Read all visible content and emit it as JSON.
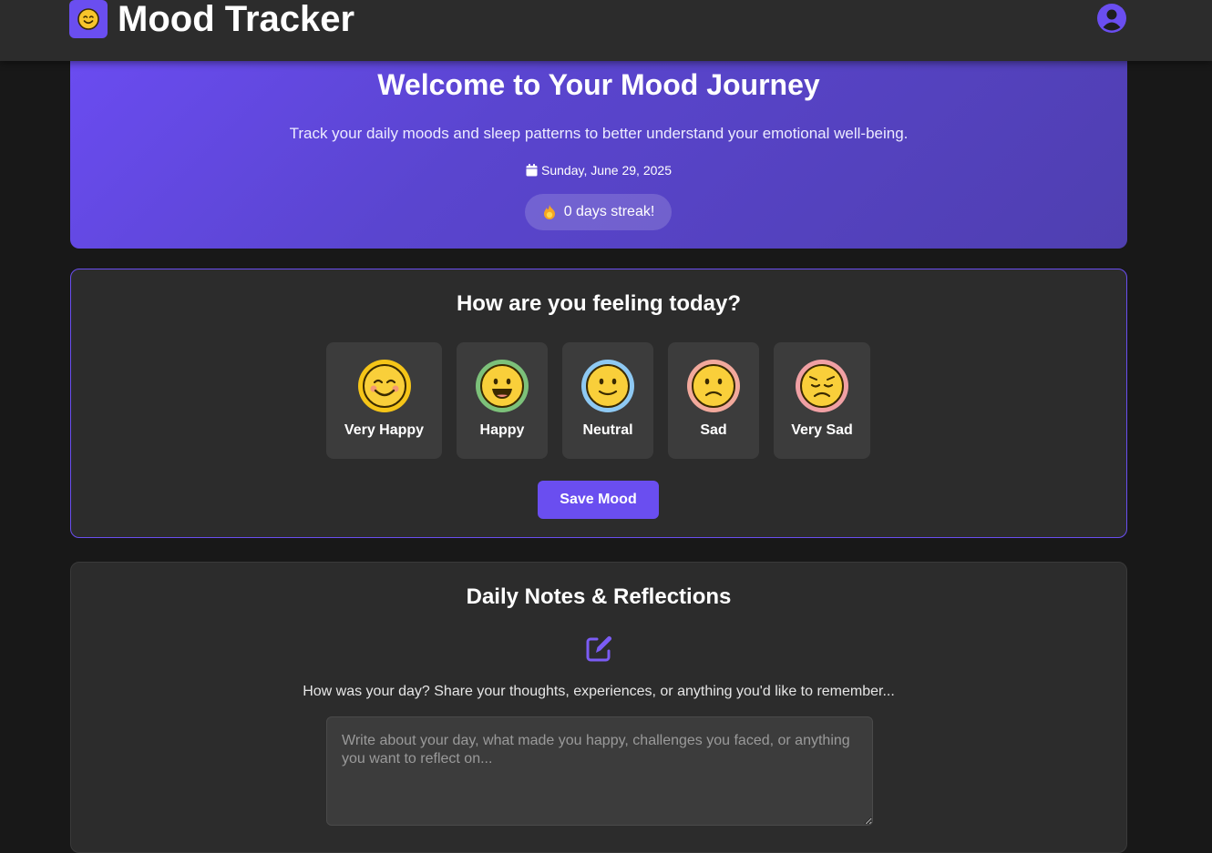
{
  "header": {
    "app_title": "Mood Tracker",
    "logo_icon": "smiley-face-icon",
    "profile_icon": "user-circle-icon",
    "accent_color": "#6a4ef0"
  },
  "hero": {
    "title": "Welcome to Your Mood Journey",
    "subtitle": "Track your daily moods and sleep patterns to better understand your emotional well-being.",
    "date": "Sunday, June 29, 2025",
    "date_icon": "calendar-icon",
    "streak": "0 days streak!",
    "streak_icon": "fire-icon"
  },
  "mood_card": {
    "title": "How are you feeling today?",
    "options": [
      {
        "label": "Very Happy",
        "icon": "very-happy-face-icon",
        "ring": "#f5c518"
      },
      {
        "label": "Happy",
        "icon": "happy-face-icon",
        "ring": "#7cc17a"
      },
      {
        "label": "Neutral",
        "icon": "neutral-face-icon",
        "ring": "#8ec9f3"
      },
      {
        "label": "Sad",
        "icon": "sad-face-icon",
        "ring": "#f2a99c"
      },
      {
        "label": "Very Sad",
        "icon": "very-sad-face-icon",
        "ring": "#f0a0a4"
      }
    ],
    "save_label": "Save Mood"
  },
  "notes_card": {
    "title": "Daily Notes & Reflections",
    "icon": "edit-pen-icon",
    "prompt": "How was your day? Share your thoughts, experiences, or anything you'd like to remember...",
    "placeholder": "Write about your day, what made you happy, challenges you faced, or anything you want to reflect on...",
    "value": ""
  }
}
